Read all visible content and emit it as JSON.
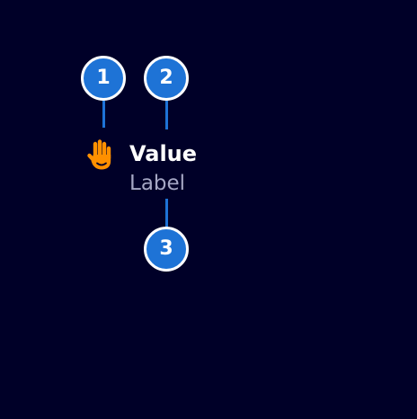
{
  "markers": [
    {
      "number": "1"
    },
    {
      "number": "2"
    },
    {
      "number": "3"
    }
  ],
  "component": {
    "icon": "raised-hand-icon",
    "value": "Value",
    "label": "Label"
  },
  "colors": {
    "background": "#000028",
    "marker_fill": "#1e73d6",
    "marker_border": "#ffffff",
    "icon": "#ff9000",
    "value_text": "#ffffff",
    "label_text": "#a5a7c4"
  }
}
